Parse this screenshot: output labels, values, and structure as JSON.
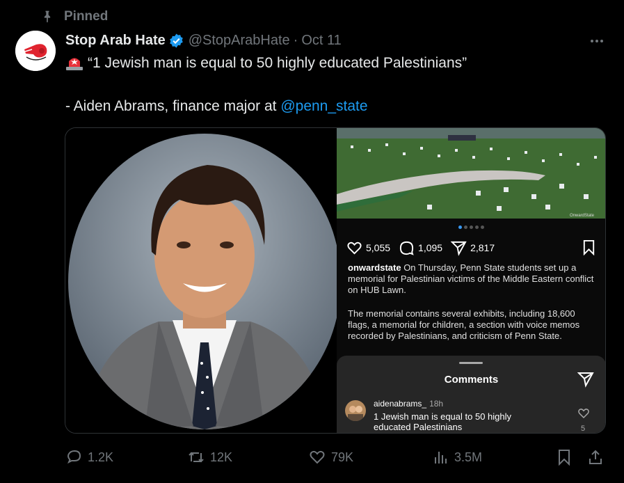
{
  "pinned_label": "Pinned",
  "account": {
    "display_name": "Stop Arab Hate",
    "handle": "@StopArabHate",
    "separator": "·",
    "date": "Oct 11",
    "verified_color": "#1d9bf0"
  },
  "tweet": {
    "line1": "“1 Jewish man is equal to 50 highly educated Palestinians”",
    "line2_prefix": "- Aiden Abrams, finance major at ",
    "mention": "@penn_state",
    "mention_color": "#1d9bf0"
  },
  "instagram": {
    "likes": "5,055",
    "comments": "1,095",
    "shares": "2,817",
    "caption_user": "onwardstate",
    "caption_body": " On Thursday, Penn State students set up a memorial for Palestinian victims of the Middle Eastern conflict on HUB Lawn.",
    "caption_para2": "The memorial contains several exhibits, including 18,600 flags, a memorial for children, a section with voice memos recorded by Palestinians, and criticism of Penn State.",
    "watermark": "OnwardState",
    "comments_title": "Comments",
    "comment": {
      "user": "aidenabrams_",
      "time": "18h",
      "text": "1 Jewish man is equal to 50 highly educated Palestinians",
      "likes": "5"
    }
  },
  "metrics": {
    "replies": "1.2K",
    "reposts": "12K",
    "likes": "79K",
    "views": "3.5M"
  },
  "icons": [
    "pin-icon",
    "verified-icon",
    "more-icon",
    "siren-icon",
    "heart-icon",
    "comment-icon",
    "send-icon",
    "bookmark-icon",
    "reply-icon",
    "repost-icon",
    "views-icon",
    "share-icon"
  ]
}
